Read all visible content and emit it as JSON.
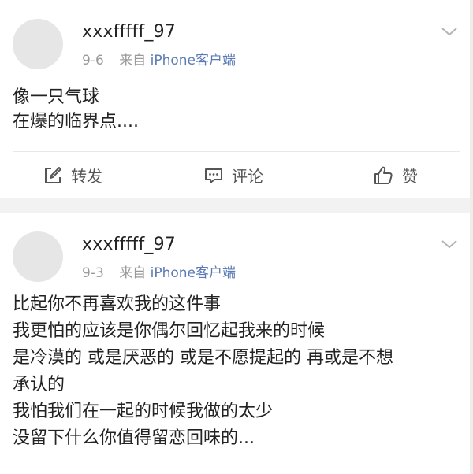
{
  "posts": [
    {
      "username": "xxxfffff_97",
      "date": "9-6",
      "source_prefix": "来自",
      "source_app": "iPhone客户端",
      "lines": [
        "像一只气球",
        "在爆的临界点...."
      ],
      "actions": {
        "repost": "转发",
        "comment": "评论",
        "like": "赞"
      }
    },
    {
      "username": "xxxfffff_97",
      "date": "9-3",
      "source_prefix": "来自",
      "source_app": "iPhone客户端",
      "lines": [
        "比起你不再喜欢我的这件事",
        "我更怕的应该是你偶尔回忆起我来的时候",
        "是冷漠的 或是厌恶的 或是不愿提起的 再或是不想",
        "承认的",
        "我怕我们在一起的时候我做的太少",
        "没留下什么你值得留恋回味的..."
      ]
    }
  ],
  "icons": {
    "repost": "edit-square-icon",
    "comment": "comment-bubble-icon",
    "like": "thumbs-up-icon",
    "more": "chevron-down-icon"
  }
}
